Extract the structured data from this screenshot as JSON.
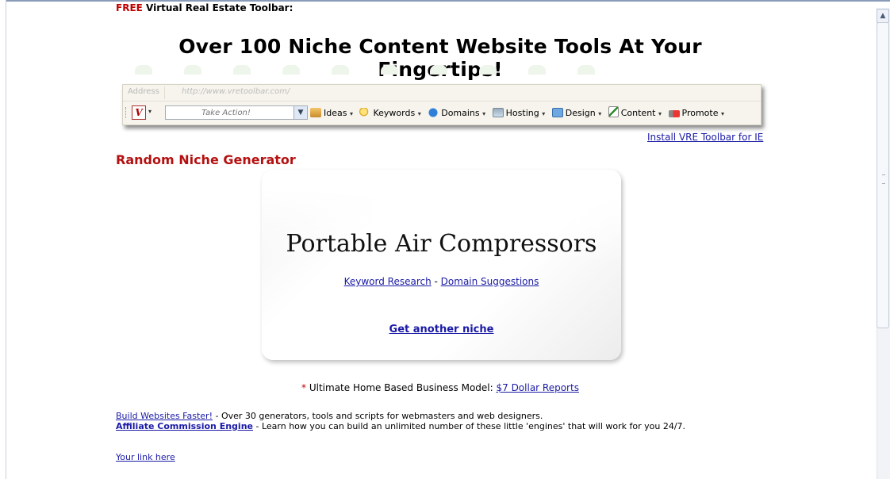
{
  "header": {
    "free_label": "FREE",
    "free_rest": " Virtual Real Estate Toolbar:",
    "headline": "Over 100 Niche Content Website Tools At Your Fingertips!"
  },
  "toolbar": {
    "address_label": "Address",
    "address_url": "http://www.vretoolbar.com/",
    "logo_letter": "V",
    "action_placeholder": "Take Action!",
    "menus": [
      {
        "label": "Ideas",
        "icon": "ideas-icon"
      },
      {
        "label": "Keywords",
        "icon": "magnifier-icon"
      },
      {
        "label": "Domains",
        "icon": "globe-icon"
      },
      {
        "label": "Hosting",
        "icon": "server-icon"
      },
      {
        "label": "Design",
        "icon": "window-icon"
      },
      {
        "label": "Content",
        "icon": "document-pen-icon"
      },
      {
        "label": "Promote",
        "icon": "megaphone-icon"
      }
    ],
    "dropdown_glyph": "▾",
    "install_link": "Install VRE Toolbar for IE"
  },
  "generator": {
    "title": "Random Niche Generator",
    "niche": "Portable Air Compressors",
    "keyword_research": "Keyword Research",
    "separator": " - ",
    "domain_suggestions": "Domain Suggestions",
    "another": "Get another niche"
  },
  "promo": {
    "star": "*",
    "text": " Ultimate Home Based Business Model: ",
    "link": "$7 Dollar Reports"
  },
  "footer_links": [
    {
      "link": "Build Websites Faster!",
      "text": " - Over 30 generators, tools and scripts for webmasters and web designers.",
      "bold": false
    },
    {
      "link": "Affiliate Commission Engine",
      "text": " - Learn how you can build an unlimited number of these little 'engines' that will work for you 24/7.",
      "bold": true
    }
  ],
  "your_link": "Your link here",
  "colors": {
    "accent_red": "#b41010",
    "link_blue": "#1a1aa6"
  }
}
